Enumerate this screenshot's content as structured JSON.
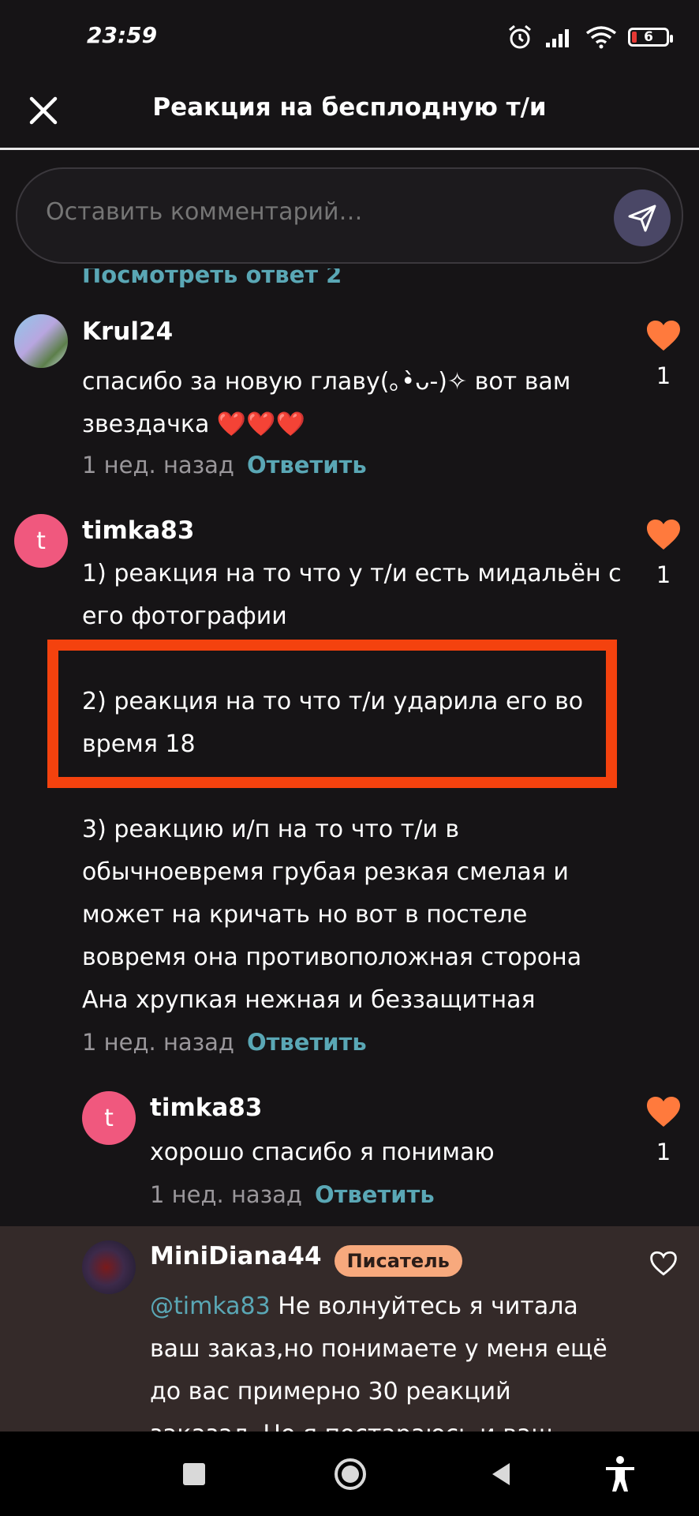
{
  "status": {
    "time": "23:59",
    "battery_level": "6"
  },
  "header": {
    "title": "Реакция на бесплодную т/и"
  },
  "comment_input": {
    "placeholder": "Оставить комментарий…"
  },
  "view_replies": "Посмотреть ответ 2",
  "comments": [
    {
      "user": "Krul24",
      "text_lines": [
        "спасибо за новую главу(｡•̀ᴗ-)✧ вот вам",
        "звездачка ❤️❤️❤️"
      ],
      "time": "1 нед. назад",
      "reply": "Ответить",
      "likes": "1"
    },
    {
      "user": "timka83",
      "avatar_letter": "t",
      "text_1": [
        "1) реакция на то что у т/и есть мидальён с",
        "его фотографии"
      ],
      "text_2": [
        "2) реакция на то что т/и ударила его во",
        "время 18"
      ],
      "text_3": [
        "3) реакцию и/п на то что т/и в",
        "обычноевремя грубая резкая смелая и",
        "может на кричать но вот в постеле",
        "вовремя она противоположная сторона",
        "Ана хрупкая нежная и беззащитная"
      ],
      "time": "1 нед. назад",
      "reply": "Ответить",
      "likes": "1"
    },
    {
      "user": "timka83",
      "avatar_letter": "t",
      "text": "хорошо спасибо я понимаю",
      "time": "1 нед. назад",
      "reply": "Ответить",
      "likes": "1"
    },
    {
      "user": "MiniDiana44",
      "badge": "Писатель",
      "mention": "@timka83",
      "text_first": " Не волнуйтесь я читала",
      "text_lines": [
        "ваш заказ,но понимаете у меня ещё",
        "до вас примерно 30 реакций",
        "заказал. Но я постараюсь и ваш"
      ]
    }
  ],
  "colors": {
    "accent": "#5aa7b5",
    "heart": "#ff7a3d",
    "highlight": "#f4420e",
    "avatar_pink": "#f0587e"
  }
}
